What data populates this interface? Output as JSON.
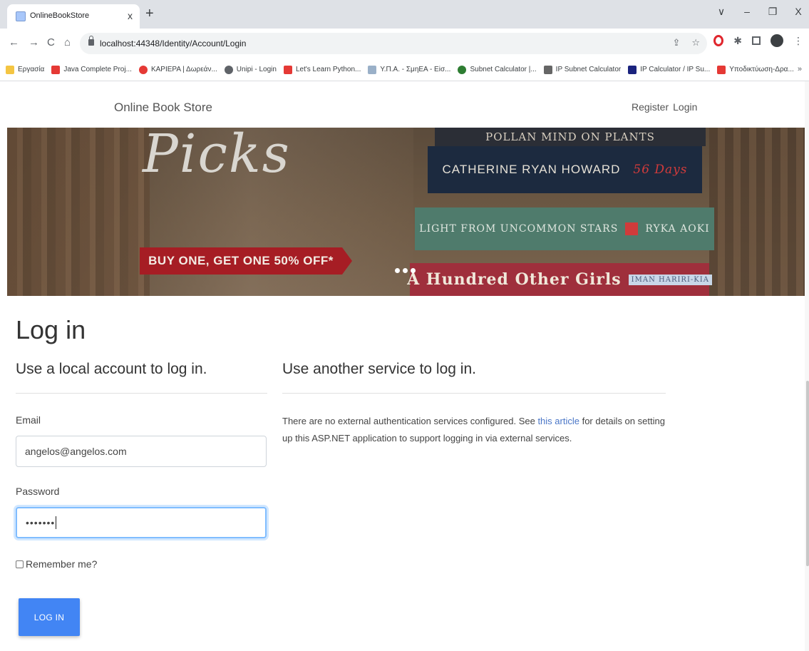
{
  "browser": {
    "tab_title": "OnlineBookStore",
    "tab_close": "x",
    "new_tab": "+",
    "window_controls": [
      "∨",
      "–",
      "❐",
      "X"
    ],
    "url": "localhost:44348/Identity/Account/Login",
    "nav": {
      "back": "←",
      "forward": "→",
      "reload": "C",
      "home": "⌂"
    },
    "omnibox_icons": [
      "⇪",
      "☆"
    ],
    "bookmarks": [
      {
        "label": "Εργασία",
        "color": "#f4c542"
      },
      {
        "label": "Java Complete Proj...",
        "color": "#e53935"
      },
      {
        "label": "ΚΑΡΙΕΡΑ | Δωρεάν...",
        "color": "#e53935"
      },
      {
        "label": "Unipi - Login",
        "color": "#5f6368"
      },
      {
        "label": "Let's Learn Python...",
        "color": "#e53935"
      },
      {
        "label": "Υ.Π.Α. - ΣμηΕΑ - Εiσ...",
        "color": "#9ab0c8"
      },
      {
        "label": "Subnet Calculator |...",
        "color": "#2e7d32"
      },
      {
        "label": "IP Subnet Calculator",
        "color": "#666666"
      },
      {
        "label": "IP Calculator / IP Su...",
        "color": "#1a237e"
      },
      {
        "label": "Υποδικτύωση-Δρα...",
        "color": "#e53935"
      }
    ],
    "bookmarks_more": "»"
  },
  "site": {
    "brand": "Online Book Store",
    "nav_register": "Register",
    "nav_login": "Login"
  },
  "banner": {
    "headline": "Picks",
    "promo": "BUY ONE, GET ONE 50% OFF*",
    "book1": "POLLAN       MIND ON PLANTS",
    "book2": "CATHERINE RYAN HOWARD",
    "book2_accent": "56 Days",
    "book3_left": "LIGHT FROM UNCOMMON STARS",
    "book3_right": "RYKA AOKI",
    "book4": "A Hundred Other Girls",
    "book4_author": "IMAN HARIRI-KIA"
  },
  "login": {
    "title": "Log in",
    "local_heading": "Use a local account to log in.",
    "external_heading": "Use another service to log in.",
    "email_label": "Email",
    "email_value": "angelos@angelos.com",
    "password_label": "Password",
    "password_value": "•••••••",
    "remember_label": "Remember me?",
    "submit": "LOG IN",
    "external_text_before": "There are no external authentication services configured. See ",
    "external_link": "this article",
    "external_text_after": " for details on setting up this ASP.NET application to support logging in via external services."
  }
}
